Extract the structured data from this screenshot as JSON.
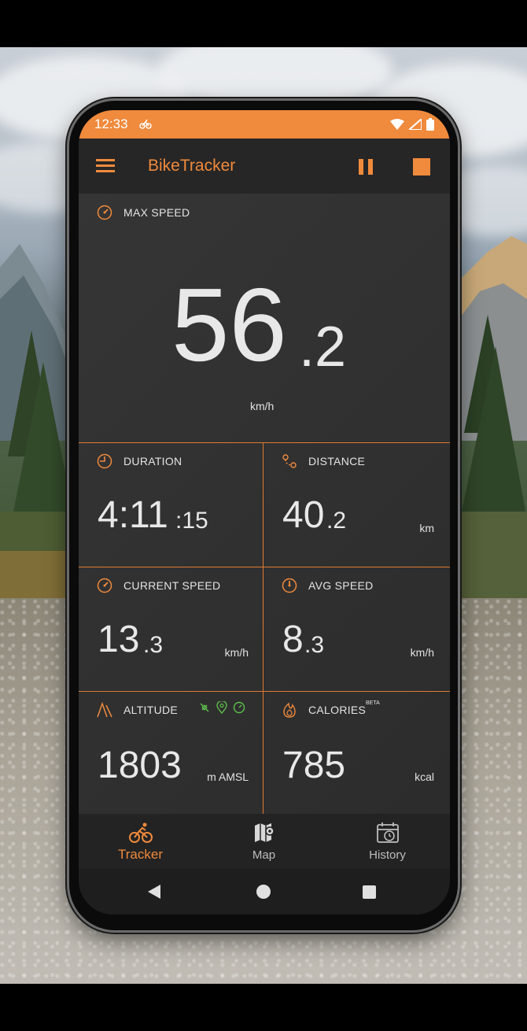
{
  "status_bar": {
    "time": "12:33",
    "icons": [
      "bike-notification-icon",
      "wifi-icon",
      "signal-icon",
      "battery-icon"
    ]
  },
  "app_bar": {
    "title": "BikeTracker",
    "icons": [
      "menu-icon",
      "pause-icon",
      "stop-icon"
    ]
  },
  "max_speed": {
    "label": "MAX SPEED",
    "value_int": "56",
    "value_dec": ".2",
    "unit": "km/h",
    "icon": "speedometer-icon"
  },
  "duration": {
    "label": "DURATION",
    "value_main": "4:11",
    "value_sec": ":15",
    "icon": "clock-icon"
  },
  "distance": {
    "label": "DISTANCE",
    "value_int": "40",
    "value_dec": ".2",
    "unit": "km",
    "icon": "route-icon"
  },
  "current_speed": {
    "label": "CURRENT SPEED",
    "value_int": "13",
    "value_dec": ".3",
    "unit": "km/h",
    "icon": "speedometer-icon"
  },
  "avg_speed": {
    "label": "AVG SPEED",
    "value_int": "8",
    "value_dec": ".3",
    "unit": "km/h",
    "icon": "speedometer-icon"
  },
  "altitude": {
    "label": "ALTITUDE",
    "value": "1803",
    "unit": "m AMSL",
    "icon": "mountain-icon",
    "source_icons": [
      "satellite-icon",
      "location-pin-icon",
      "barometer-icon"
    ]
  },
  "calories": {
    "label": "CALORIES",
    "badge": "BETA",
    "value": "785",
    "unit": "kcal",
    "icon": "flame-icon"
  },
  "bottom_nav": {
    "items": [
      {
        "label": "Tracker",
        "icon": "cyclist-icon",
        "active": true
      },
      {
        "label": "Map",
        "icon": "map-icon",
        "active": false
      },
      {
        "label": "History",
        "icon": "calendar-clock-icon",
        "active": false
      }
    ]
  },
  "colors": {
    "accent": "#f08a3c",
    "background": "#2e2e2e",
    "text": "#e8e8e8",
    "source_icon_green": "#5cbf4a"
  }
}
